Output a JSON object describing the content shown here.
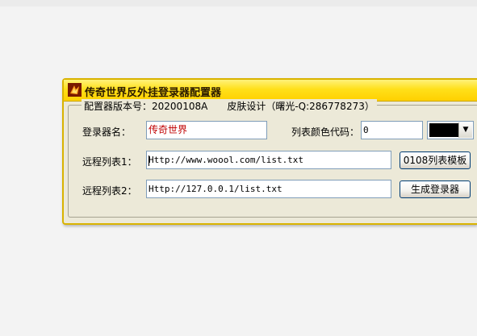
{
  "window": {
    "title": "传奇世界反外挂登录器配置器"
  },
  "group": {
    "version_label": "配置器版本号：",
    "version_value": "20200108A",
    "skin_credit": "皮肤设计（曙光-Q:286778273）"
  },
  "form": {
    "launcher_name_label": "登录器名：",
    "launcher_name_value": "传奇世界",
    "list_color_label": "列表颜色代码：",
    "list_color_value": "0",
    "list_color_swatch": "#000000",
    "remote_list1_label": "远程列表1：",
    "remote_list1_value": "Http://www.woool.com/list.txt",
    "remote_list2_label": "远程列表2：",
    "remote_list2_value": "Http://127.0.0.1/list.txt"
  },
  "buttons": {
    "template_label": "0108列表模板",
    "generate_label": "生成登录器"
  },
  "icons": {
    "app": "dragon-app-icon",
    "dropdown": "chevron-down-icon"
  },
  "colors": {
    "titlebar": "#ffd000",
    "window_border": "#d9b300",
    "face": "#ece9d8",
    "name_text": "#c00000"
  }
}
